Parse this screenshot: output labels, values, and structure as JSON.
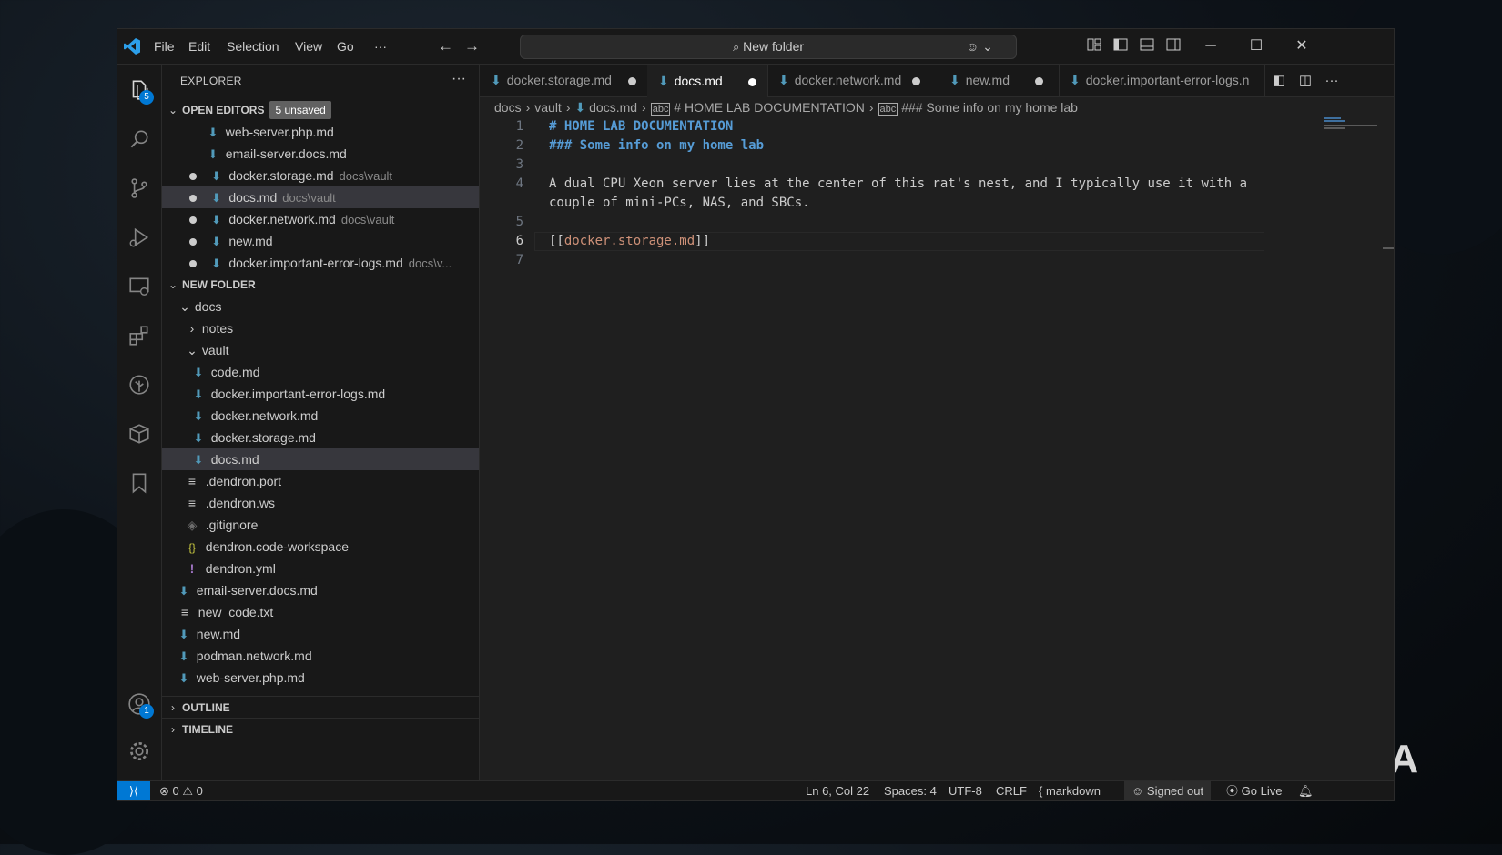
{
  "menu": {
    "file": "File",
    "edit": "Edit",
    "selection": "Selection",
    "view": "View",
    "go": "Go",
    "more": "···"
  },
  "command_center": {
    "label": "New folder"
  },
  "activity_bar": {
    "explorer_badge": "5",
    "accounts_badge": "1"
  },
  "sidebar": {
    "title": "EXPLORER",
    "more": "···",
    "open_editors": {
      "title": "OPEN EDITORS",
      "badge": "5 unsaved",
      "items": [
        {
          "name": "web-server.php.md",
          "desc": ""
        },
        {
          "name": "email-server.docs.md",
          "desc": ""
        },
        {
          "name": "docker.storage.md",
          "desc": "docs\\vault"
        },
        {
          "name": "docs.md",
          "desc": "docs\\vault"
        },
        {
          "name": "docker.network.md",
          "desc": "docs\\vault"
        },
        {
          "name": "new.md",
          "desc": ""
        },
        {
          "name": "docker.important-error-logs.md",
          "desc": "docs\\v..."
        }
      ]
    },
    "folder": {
      "title": "NEW FOLDER",
      "docs": "docs",
      "notes": "notes",
      "vault": "vault",
      "vault_files": [
        "code.md",
        "docker.important-error-logs.md",
        "docker.network.md",
        "docker.storage.md",
        "docs.md"
      ],
      "docs_files": [
        ".dendron.port",
        ".dendron.ws",
        ".gitignore",
        "dendron.code-workspace",
        "dendron.yml"
      ],
      "root_files": [
        "email-server.docs.md",
        "new_code.txt",
        "new.md",
        "podman.network.md",
        "web-server.php.md"
      ]
    },
    "outline": "OUTLINE",
    "timeline": "TIMELINE"
  },
  "tabs": [
    {
      "label": "docker.storage.md"
    },
    {
      "label": "docs.md"
    },
    {
      "label": "docker.network.md"
    },
    {
      "label": "new.md"
    },
    {
      "label": "docker.important-error-logs.n"
    }
  ],
  "breadcrumb": {
    "docs": "docs",
    "vault": "vault",
    "file": "docs.md",
    "h1": "# HOME LAB DOCUMENTATION",
    "h3": "### Some info on my home lab"
  },
  "code": {
    "line_numbers": [
      "1",
      "2",
      "3",
      "4",
      "",
      "5",
      "6",
      "7"
    ],
    "l1": "# HOME LAB DOCUMENTATION",
    "l2": "### Some info on my home lab",
    "l4a": "A dual CPU Xeon server lies at the center of this rat's nest, and I typically use it with a",
    "l4b": "couple of mini-PCs, NAS, and SBCs.",
    "l6_open": "[[",
    "l6_link": "docker.storage.md",
    "l6_close": "]]"
  },
  "status": {
    "errors": "0",
    "warnings": "0",
    "position": "Ln 6, Col 22",
    "spaces": "Spaces: 4",
    "encoding": "UTF-8",
    "eol": "CRLF",
    "language": "markdown",
    "account": "Signed out",
    "golive": "Go Live"
  },
  "watermark": "XDA",
  "colors": {
    "accent": "#0078d4",
    "markdown_icon": "#519aba",
    "heading": "#569cd6",
    "link": "#ce9178"
  }
}
